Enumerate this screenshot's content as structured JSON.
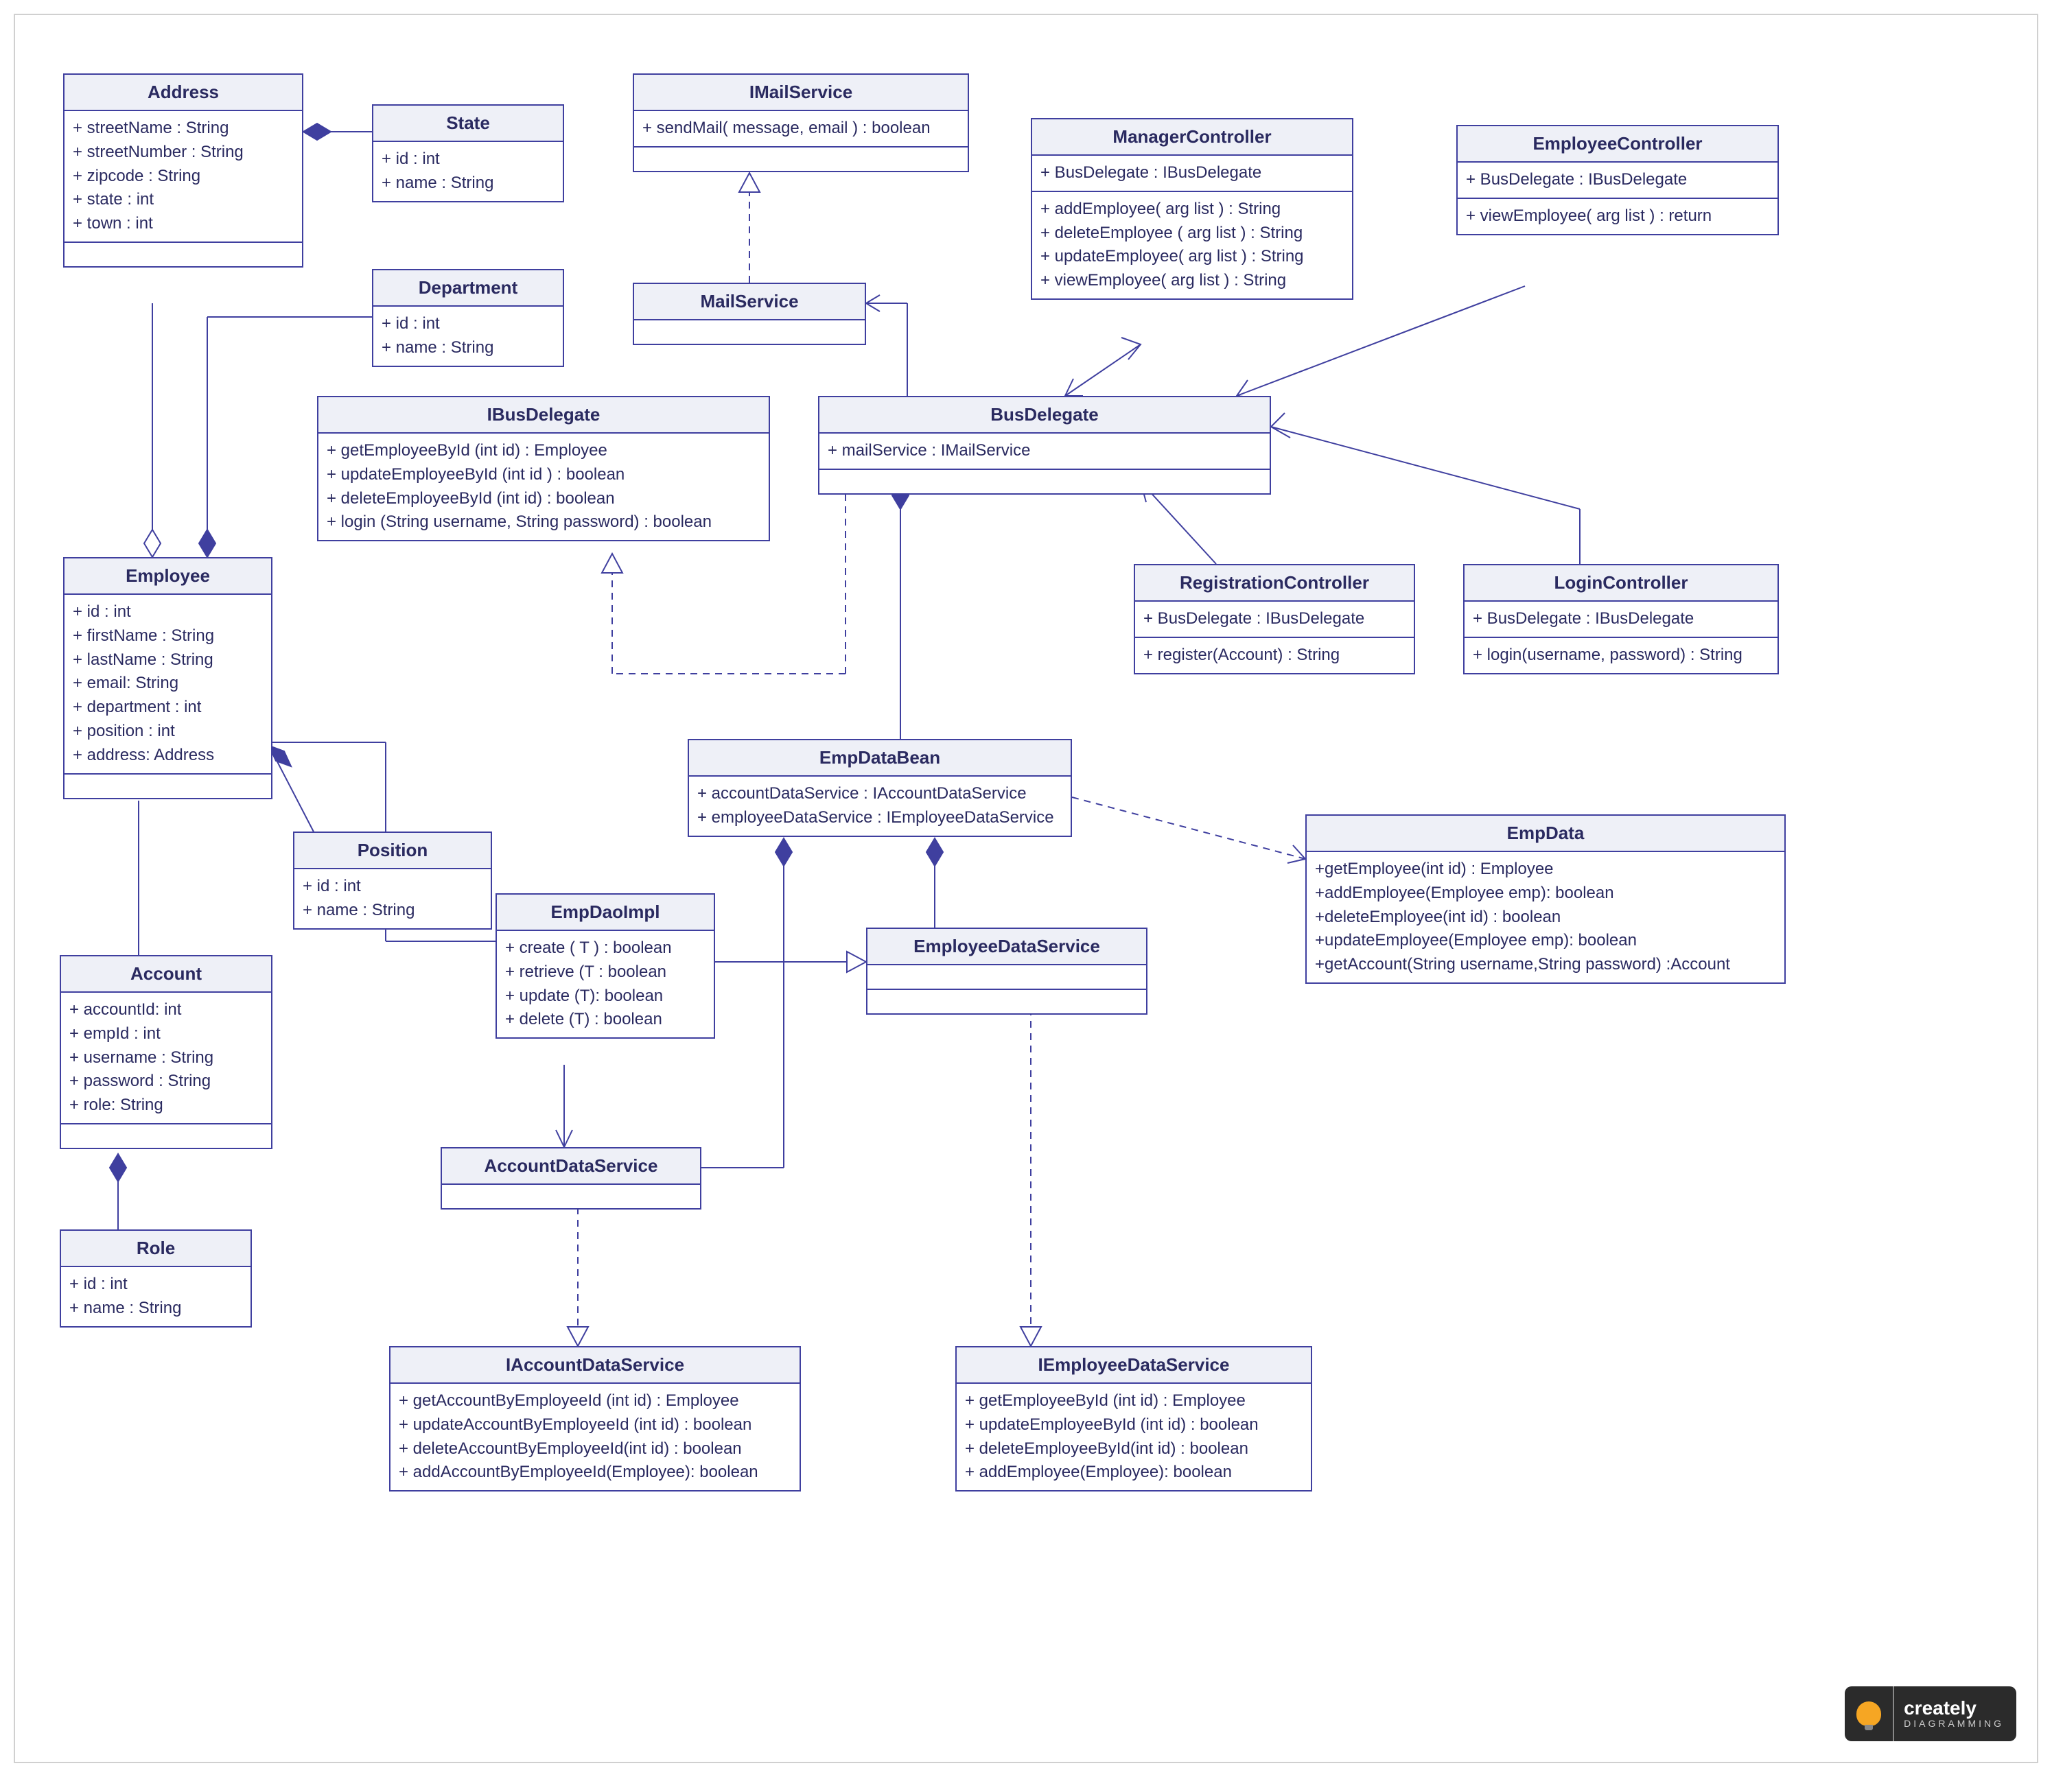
{
  "classes": {
    "Address": {
      "name": "Address",
      "attrs": [
        "+ streetName : String",
        "+ streetNumber : String",
        "+ zipcode : String",
        "+ state : int",
        "+ town : int"
      ]
    },
    "State": {
      "name": "State",
      "attrs": [
        "+ id : int",
        "+ name : String"
      ]
    },
    "Department": {
      "name": "Department",
      "attrs": [
        "+ id : int",
        "+ name : String"
      ]
    },
    "IMailService": {
      "name": "IMailService",
      "ops": [
        "+ sendMail( message, email ) :   boolean"
      ]
    },
    "MailService": {
      "name": "MailService"
    },
    "ManagerController": {
      "name": "ManagerController",
      "attrs": [
        "+ BusDelegate : IBusDelegate"
      ],
      "ops": [
        "+  addEmployee( arg list ) : String",
        "+ deleteEmployee ( arg list ) : String",
        "+ updateEmployee( arg list ) : String",
        "+ viewEmployee( arg list ) : String"
      ]
    },
    "EmployeeController": {
      "name": "EmployeeController",
      "attrs": [
        "+ BusDelegate : IBusDelegate"
      ],
      "ops": [
        "+ viewEmployee( arg list ) : return"
      ]
    },
    "IBusDelegate": {
      "name": "IBusDelegate",
      "ops": [
        "+ getEmployeeById (int id) : Employee",
        "+ updateEmployeeById (int id ) : boolean",
        "+ deleteEmployeeById (int id) : boolean",
        "+ login (String username, String password) : boolean"
      ]
    },
    "BusDelegate": {
      "name": "BusDelegate",
      "attrs": [
        "+ mailService : IMailService"
      ]
    },
    "Employee": {
      "name": "Employee",
      "attrs": [
        "+ id : int",
        "+ firstName : String",
        "+ lastName : String",
        "+ email: String",
        "+ department : int",
        "+ position : int",
        "+ address: Address"
      ]
    },
    "RegistrationController": {
      "name": "RegistrationController",
      "attrs": [
        "+ BusDelegate : IBusDelegate"
      ],
      "ops": [
        "+ register(Account) : String"
      ]
    },
    "LoginController": {
      "name": "LoginController",
      "attrs": [
        "+ BusDelegate : IBusDelegate"
      ],
      "ops": [
        "+ login(username, password) : String"
      ]
    },
    "EmpDataBean": {
      "name": "EmpDataBean",
      "attrs": [
        "+ accountDataService : IAccountDataService",
        "+ employeeDataService : IEmployeeDataService"
      ]
    },
    "Position": {
      "name": "Position",
      "attrs": [
        "+ id : int",
        "+ name : String"
      ]
    },
    "EmpDaoImpl": {
      "name": "EmpDaoImpl",
      "ops": [
        "+ create ( T ) : boolean",
        "+ retrieve (T : boolean",
        "+ update (T): boolean",
        "+ delete (T) : boolean"
      ]
    },
    "EmployeeDataService": {
      "name": "EmployeeDataService"
    },
    "EmpData": {
      "name": "EmpData",
      "ops": [
        "+getEmployee(int id) : Employee",
        "+addEmployee(Employee emp): boolean",
        "+deleteEmployee(int id) : boolean",
        "+updateEmployee(Employee emp): boolean",
        "+getAccount(String username,String password) :Account"
      ]
    },
    "Account": {
      "name": "Account",
      "attrs": [
        "+ accountId: int",
        "+ empId : int",
        "+ username : String",
        "+ password : String",
        "+ role: String"
      ]
    },
    "AccountDataService": {
      "name": "AccountDataService"
    },
    "Role": {
      "name": "Role",
      "attrs": [
        "+ id : int",
        "+ name : String"
      ]
    },
    "IAccountDataService": {
      "name": "IAccountDataService",
      "ops": [
        "+ getAccountByEmployeeId (int id) : Employee",
        "+ updateAccountByEmployeeId (int id) : boolean",
        "+ deleteAccountByEmployeeId(int id) : boolean",
        "+ addAccountByEmployeeId(Employee): boolean"
      ]
    },
    "IEmployeeDataService": {
      "name": "IEmployeeDataService",
      "ops": [
        "+ getEmployeeById (int id) : Employee",
        "+ updateEmployeeById (int id) : boolean",
        "+ deleteEmployeeById(int id) : boolean",
        "+ addEmployee(Employee): boolean"
      ]
    }
  },
  "badge": {
    "brand": "creately",
    "sub": "DIAGRAMMING"
  }
}
